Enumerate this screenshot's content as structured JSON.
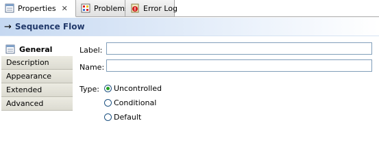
{
  "tabs": [
    {
      "label": "Properties",
      "close": "✕",
      "active": true
    },
    {
      "label": "Problems",
      "active": false
    },
    {
      "label": "Error Log",
      "active": false
    }
  ],
  "header": {
    "arrow": "→",
    "title": "Sequence Flow"
  },
  "sidetabs": [
    {
      "label": "General",
      "selected": true
    },
    {
      "label": "Description",
      "selected": false
    },
    {
      "label": "Appearance",
      "selected": false
    },
    {
      "label": "Extended",
      "selected": false
    },
    {
      "label": "Advanced",
      "selected": false
    }
  ],
  "form": {
    "label_text": "Label:",
    "label_value": "",
    "name_text": "Name:",
    "name_value": "",
    "type_text": "Type:",
    "type_options": [
      {
        "label": "Uncontrolled",
        "checked": true
      },
      {
        "label": "Conditional",
        "checked": false
      },
      {
        "label": "Default",
        "checked": false
      }
    ]
  },
  "colors": {
    "accent_title": "#223a6b",
    "radio_selected": "#21a121"
  },
  "icons": {
    "properties_tab": "properties-sheet-icon",
    "problems_tab": "problems-icon",
    "errorlog_tab": "error-log-icon",
    "general_sidetab": "general-sheet-icon"
  }
}
